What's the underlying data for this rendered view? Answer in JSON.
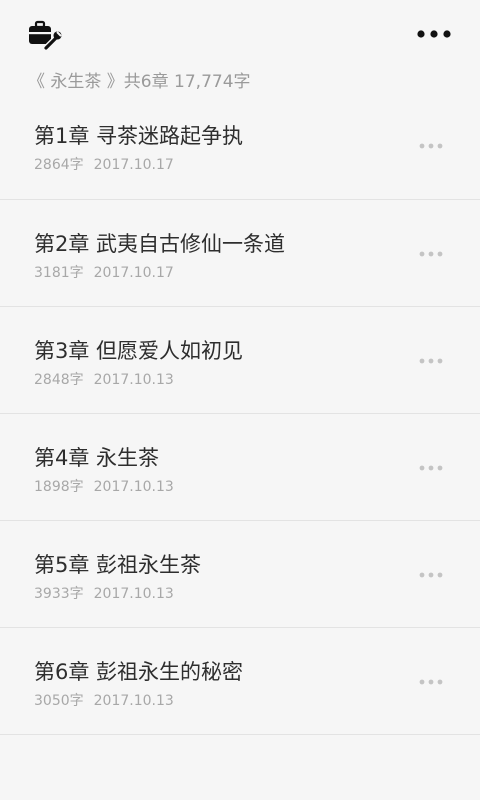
{
  "header": {
    "toolbox_icon": "toolbox-icon",
    "more_icon": "more-horizontal-icon"
  },
  "summary": {
    "text": "《 永生茶 》共6章 17,774字"
  },
  "chapters": [
    {
      "title": "第1章  寻茶迷路起争执",
      "words": "2864字",
      "date": "2017.10.17"
    },
    {
      "title": "第2章  武夷自古修仙一条道",
      "words": "3181字",
      "date": "2017.10.17"
    },
    {
      "title": "第3章  但愿爱人如初见",
      "words": "2848字",
      "date": "2017.10.13"
    },
    {
      "title": "第4章  永生茶",
      "words": "1898字",
      "date": "2017.10.13"
    },
    {
      "title": "第5章  彭祖永生茶",
      "words": "3933字",
      "date": "2017.10.13"
    },
    {
      "title": "第6章  彭祖永生的秘密",
      "words": "3050字",
      "date": "2017.10.13"
    }
  ],
  "colors": {
    "background": "#f6f6f6",
    "title": "#2e2e2e",
    "meta": "#a8a8a8",
    "divider": "#e3e3e3",
    "icon": "#111111"
  }
}
